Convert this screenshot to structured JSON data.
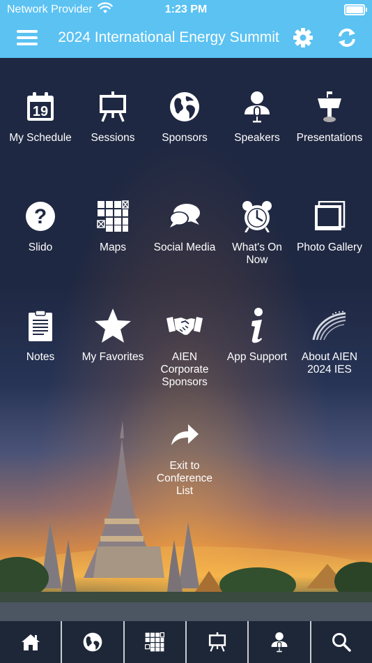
{
  "status_bar": {
    "carrier": "Network Provider",
    "time": "1:23 PM"
  },
  "header": {
    "title": "2024 International Energy Summit"
  },
  "tiles": [
    {
      "label": "My Schedule",
      "icon": "calendar-icon",
      "day": "19"
    },
    {
      "label": "Sessions",
      "icon": "easel-icon"
    },
    {
      "label": "Sponsors",
      "icon": "globe-icon"
    },
    {
      "label": "Speakers",
      "icon": "speaker-icon"
    },
    {
      "label": "Presentations",
      "icon": "lectern-icon"
    },
    {
      "label": "Slido",
      "icon": "question-icon"
    },
    {
      "label": "Maps",
      "icon": "map-grid-icon"
    },
    {
      "label": "Social Media",
      "icon": "chat-bubbles-icon"
    },
    {
      "label": "What's On Now",
      "icon": "alarm-clock-icon"
    },
    {
      "label": "Photo Gallery",
      "icon": "photo-frames-icon"
    },
    {
      "label": "Notes",
      "icon": "clipboard-icon"
    },
    {
      "label": "My Favorites",
      "icon": "star-icon"
    },
    {
      "label": "AIEN Corporate Sponsors",
      "icon": "handshake-icon"
    },
    {
      "label": "App Support",
      "icon": "info-icon"
    },
    {
      "label": "About AIEN 2024 IES",
      "icon": "swoosh-icon"
    },
    {
      "label": "Exit to Conference List",
      "icon": "share-arrow-icon"
    }
  ],
  "tab_bar": [
    {
      "name": "home",
      "icon": "home-icon"
    },
    {
      "name": "sponsors",
      "icon": "globe-icon"
    },
    {
      "name": "maps",
      "icon": "map-grid-icon"
    },
    {
      "name": "sessions",
      "icon": "easel-icon"
    },
    {
      "name": "speakers",
      "icon": "speaker-icon"
    },
    {
      "name": "search",
      "icon": "search-icon"
    }
  ],
  "colors": {
    "header_bg": "#5bc2f2",
    "tab_bar_bg": "#1e2738",
    "background_top": "#1f2842"
  }
}
